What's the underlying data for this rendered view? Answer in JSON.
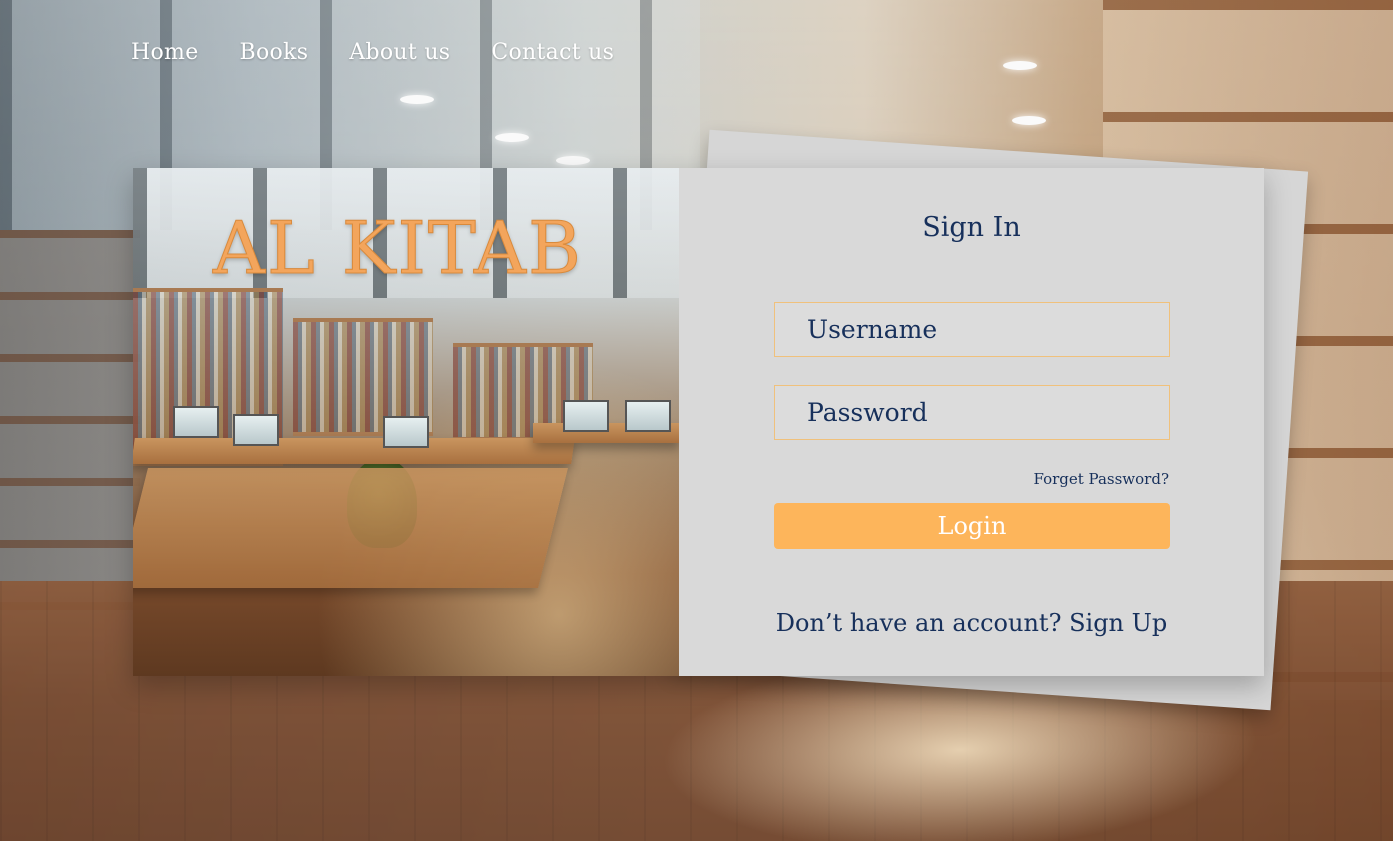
{
  "nav": {
    "items": [
      {
        "label": "Home"
      },
      {
        "label": "Books"
      },
      {
        "label": "About us"
      },
      {
        "label": "Contact us"
      }
    ]
  },
  "brand": {
    "title": "AL KITAB"
  },
  "signin": {
    "title": "Sign In",
    "username_placeholder": "Username",
    "password_placeholder": "Password",
    "forgot_label": "Forget Password?",
    "login_label": "Login",
    "no_account_text": "Don’t have an account?",
    "signup_label": "Sign Up"
  },
  "colors": {
    "primary_text": "#17305b",
    "accent": "#fdb55b",
    "card_bg": "#d9d9d9",
    "brand": "#f3a55c"
  }
}
